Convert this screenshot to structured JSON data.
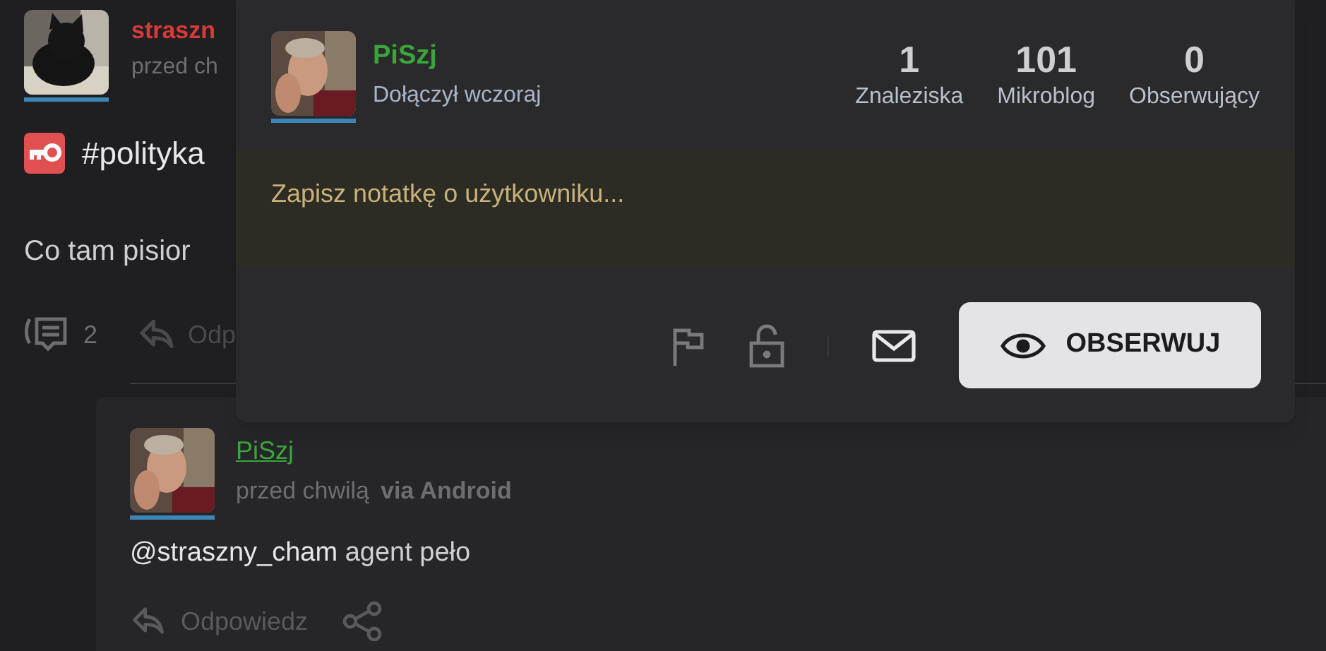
{
  "post": {
    "author": "straszn",
    "time": "przed ch",
    "tag": "#polityka",
    "body": "Co tam pisior",
    "comment_count": "2",
    "reply": "Odp"
  },
  "comment": {
    "author": "PiSzj",
    "time": "przed chwilą",
    "via": "via Android",
    "mention": "@straszny_cham",
    "body": "agent peło",
    "reply": "Odpowiedz"
  },
  "popup": {
    "name": "PiSzj",
    "joined": "Dołączył wczoraj",
    "stats": [
      {
        "value": "1",
        "label": "Znaleziska"
      },
      {
        "value": "101",
        "label": "Mikroblog"
      },
      {
        "value": "0",
        "label": "Obserwujący"
      }
    ],
    "note": {
      "placeholder": "Zapisz notatkę o użytkowniku..."
    },
    "follow_button": "OBSERWUJ"
  }
}
